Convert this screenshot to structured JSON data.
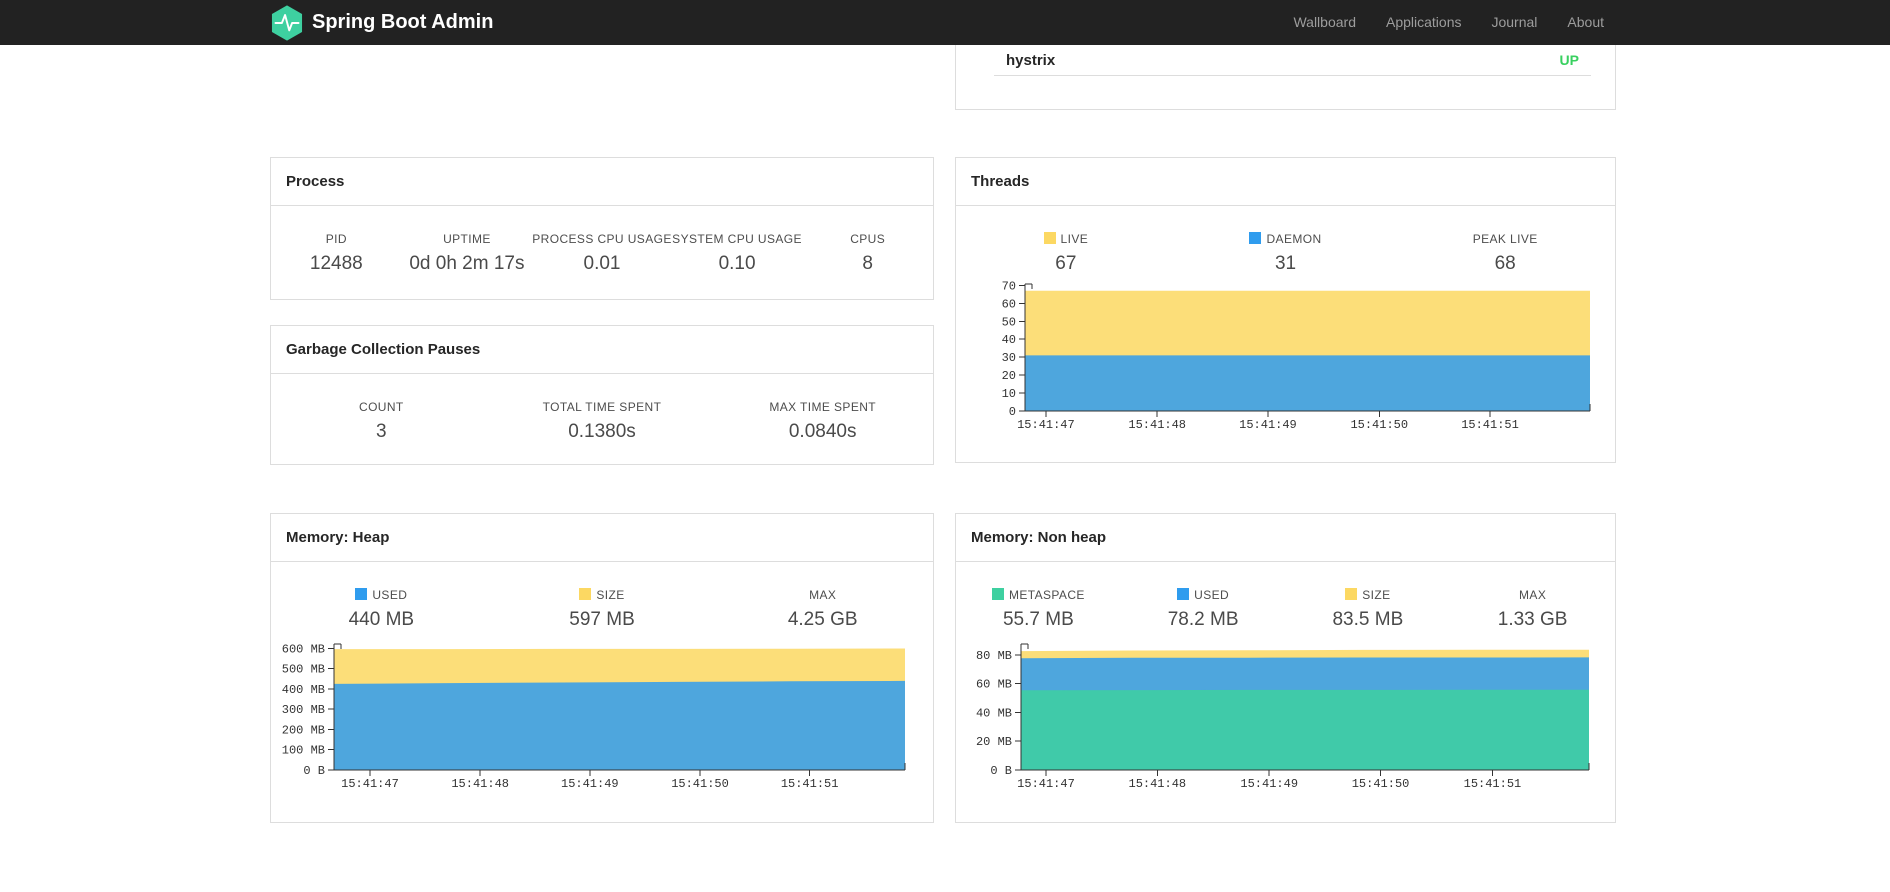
{
  "navbar": {
    "brand": "Spring Boot Admin",
    "items": [
      "Wallboard",
      "Applications",
      "Journal",
      "About"
    ]
  },
  "health": {
    "name": "hystrix",
    "status": "UP",
    "status_color": "#38d05f"
  },
  "cards": {
    "process": {
      "title": "Process",
      "stats": [
        {
          "label": "PID",
          "value": "12488"
        },
        {
          "label": "UPTIME",
          "value": "0d 0h 2m 17s"
        },
        {
          "label": "PROCESS CPU USAGE",
          "value": "0.01"
        },
        {
          "label": "SYSTEM CPU USAGE",
          "value": "0.10"
        },
        {
          "label": "CPUS",
          "value": "8"
        }
      ]
    },
    "gc": {
      "title": "Garbage Collection Pauses",
      "stats": [
        {
          "label": "COUNT",
          "value": "3"
        },
        {
          "label": "TOTAL TIME SPENT",
          "value": "0.1380s"
        },
        {
          "label": "MAX TIME SPENT",
          "value": "0.0840s"
        }
      ]
    },
    "threads": {
      "title": "Threads",
      "stats": [
        {
          "label": "LIVE",
          "value": "67",
          "color": "#fcd862"
        },
        {
          "label": "DAEMON",
          "value": "31",
          "color": "#2f9cee"
        },
        {
          "label": "PEAK LIVE",
          "value": "68"
        }
      ]
    },
    "heap": {
      "title": "Memory: Heap",
      "stats": [
        {
          "label": "USED",
          "value": "440 MB",
          "color": "#2f9cee"
        },
        {
          "label": "SIZE",
          "value": "597 MB",
          "color": "#fcd862"
        },
        {
          "label": "MAX",
          "value": "4.25 GB"
        }
      ]
    },
    "nonheap": {
      "title": "Memory: Non heap",
      "stats": [
        {
          "label": "METASPACE",
          "value": "55.7 MB",
          "color": "#3ed0a0"
        },
        {
          "label": "USED",
          "value": "78.2 MB",
          "color": "#2f9cee"
        },
        {
          "label": "SIZE",
          "value": "83.5 MB",
          "color": "#fcd862"
        },
        {
          "label": "MAX",
          "value": "1.33 GB"
        }
      ]
    }
  },
  "chart_data": [
    {
      "id": "threads",
      "type": "area",
      "title": "Threads",
      "mode": "overlay-absolute",
      "legend_position": "top",
      "grid": false,
      "x_labels": [
        "15:41:47",
        "15:41:48",
        "15:41:49",
        "15:41:50",
        "15:41:51"
      ],
      "ylim": [
        0,
        70.8
      ],
      "y_ticks": [
        {
          "v": 0,
          "label": "0"
        },
        {
          "v": 10,
          "label": "10"
        },
        {
          "v": 20,
          "label": "20"
        },
        {
          "v": 30,
          "label": "30"
        },
        {
          "v": 40,
          "label": "40"
        },
        {
          "v": 50,
          "label": "50"
        },
        {
          "v": 60,
          "label": "60"
        },
        {
          "v": 70,
          "label": "70"
        }
      ],
      "series": [
        {
          "name": "LIVE",
          "color": "#fcd862",
          "values": [
            67,
            67,
            67,
            67,
            67,
            67
          ]
        },
        {
          "name": "DAEMON",
          "color": "#2f9cee",
          "values": [
            31,
            31,
            31,
            31,
            31,
            31
          ]
        }
      ]
    },
    {
      "id": "heap",
      "type": "area",
      "title": "Memory: Heap",
      "mode": "overlay-absolute",
      "legend_position": "top",
      "grid": false,
      "x_labels": [
        "15:41:47",
        "15:41:48",
        "15:41:49",
        "15:41:50",
        "15:41:51"
      ],
      "ylim": [
        0,
        622
      ],
      "y_ticks": [
        {
          "v": 0,
          "label": "0 B"
        },
        {
          "v": 100,
          "label": "100 MB"
        },
        {
          "v": 200,
          "label": "200 MB"
        },
        {
          "v": 300,
          "label": "300 MB"
        },
        {
          "v": 400,
          "label": "400 MB"
        },
        {
          "v": 500,
          "label": "500 MB"
        },
        {
          "v": 600,
          "label": "600 MB"
        }
      ],
      "series": [
        {
          "name": "SIZE",
          "color": "#fcd862",
          "values": [
            597,
            597,
            598,
            598,
            599,
            600
          ]
        },
        {
          "name": "USED",
          "color": "#2f9cee",
          "values": [
            425,
            429,
            432,
            435,
            438,
            440
          ]
        }
      ]
    },
    {
      "id": "nonheap",
      "type": "area",
      "title": "Memory: Non heap",
      "mode": "overlay-absolute",
      "legend_position": "top",
      "grid": false,
      "x_labels": [
        "15:41:47",
        "15:41:48",
        "15:41:49",
        "15:41:50",
        "15:41:51"
      ],
      "ylim": [
        0,
        87.5
      ],
      "y_ticks": [
        {
          "v": 0,
          "label": "0 B"
        },
        {
          "v": 20,
          "label": "20 MB"
        },
        {
          "v": 40,
          "label": "40 MB"
        },
        {
          "v": 60,
          "label": "60 MB"
        },
        {
          "v": 80,
          "label": "80 MB"
        }
      ],
      "series": [
        {
          "name": "SIZE",
          "color": "#fcd862",
          "values": [
            82.6,
            83.0,
            83.1,
            83.4,
            83.5,
            83.5
          ]
        },
        {
          "name": "USED",
          "color": "#2f9cee",
          "values": [
            77.6,
            77.9,
            78.0,
            78.1,
            78.1,
            78.2
          ]
        },
        {
          "name": "METASPACE",
          "color": "#3ed0a0",
          "values": [
            55.4,
            55.5,
            55.6,
            55.6,
            55.7,
            55.7
          ]
        }
      ]
    }
  ],
  "colors": {
    "navbar_bg": "#222222",
    "nav_link": "#9d9d9d",
    "brand_teal": "#3ed0a0",
    "status_up": "#38d05f",
    "card_border": "#dddddd",
    "accent_yellow": "#fcd862",
    "accent_blue": "#2f9cee",
    "accent_green": "#3ed0a0"
  }
}
